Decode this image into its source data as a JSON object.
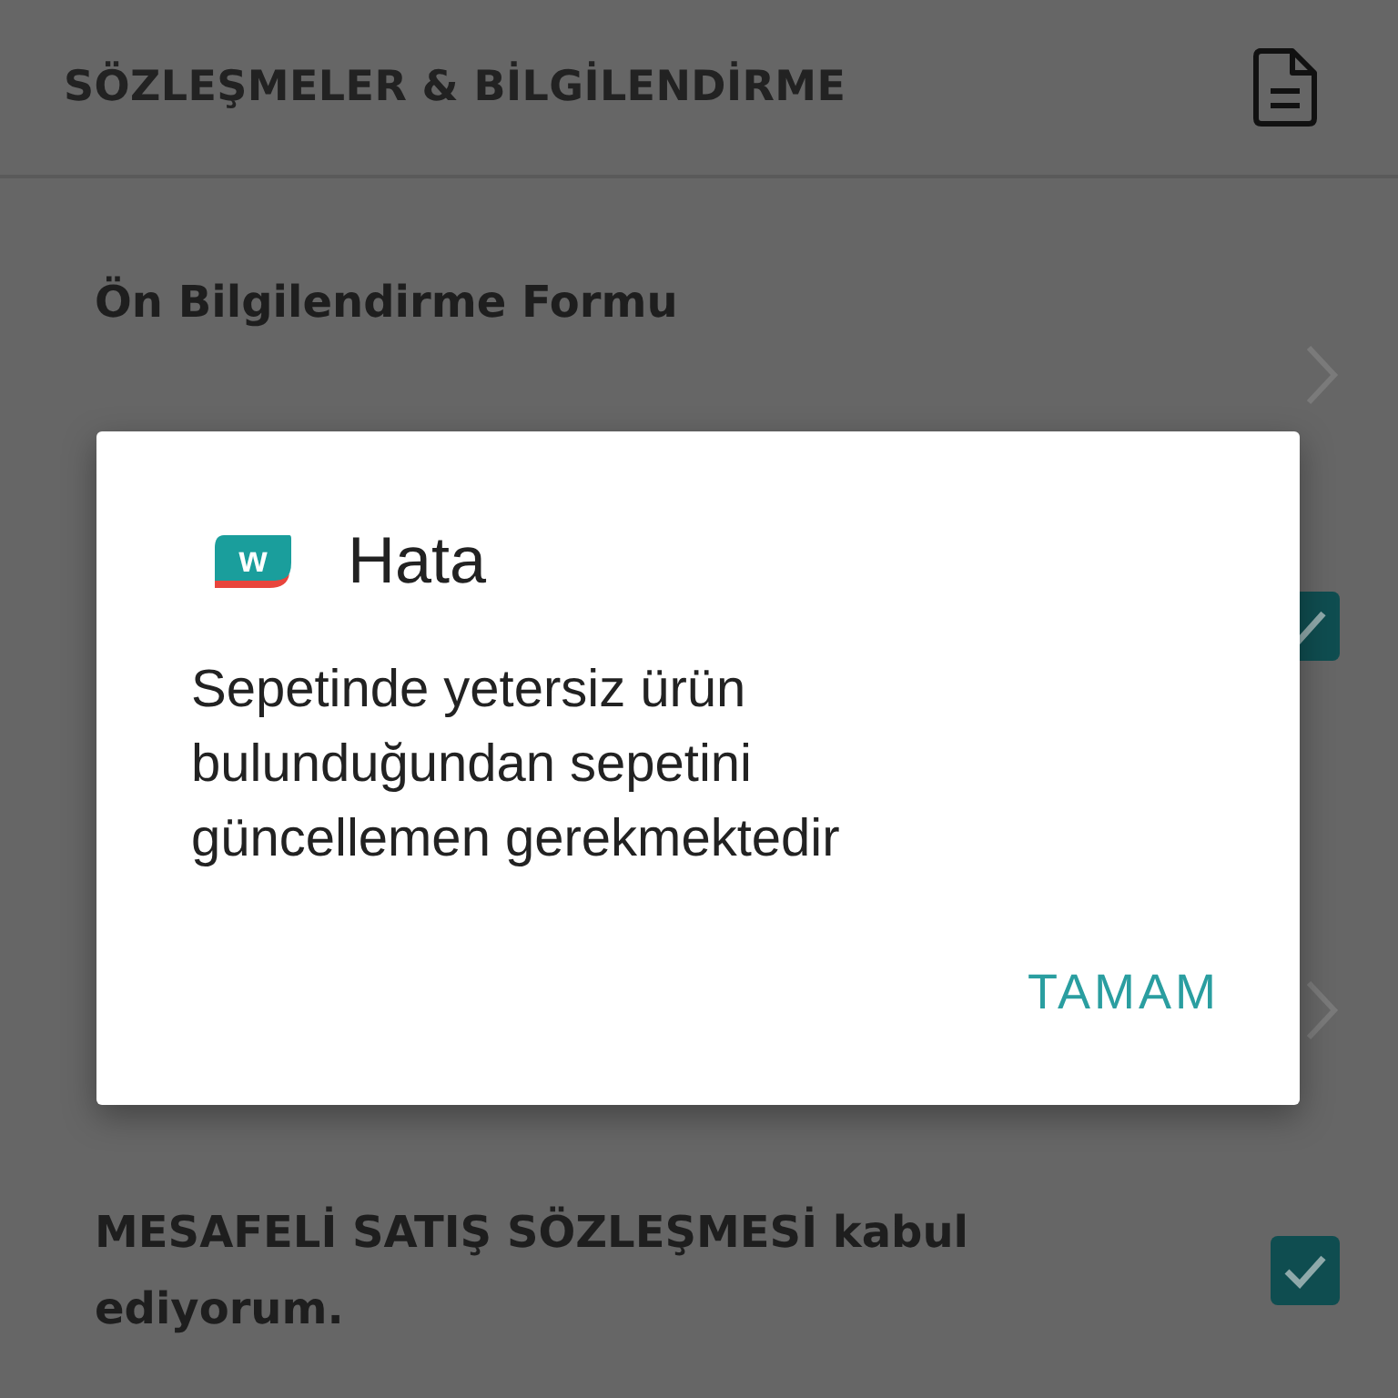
{
  "header": {
    "title": "SÖZLEŞMELER & BİLGİLENDİRME"
  },
  "rows": [
    {
      "kind": "link",
      "title": "Ön Bilgilendirme Formu"
    },
    {
      "kind": "checkbox",
      "checked": true
    },
    {
      "kind": "link"
    },
    {
      "kind": "checkbox",
      "label": "MESAFELİ SATIŞ SÖZLEŞMESİ kabul ediyorum.",
      "checked": true
    }
  ],
  "dialog": {
    "logo_letter": "w",
    "title": "Hata",
    "message": "Sepetinde yetersiz ürün bulunduğundan sepetini güncellemen gerekmektedir",
    "button": "TAMAM"
  }
}
